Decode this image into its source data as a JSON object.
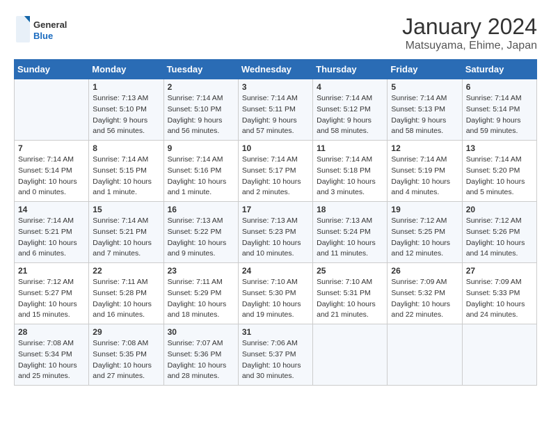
{
  "header": {
    "logo_general": "General",
    "logo_blue": "Blue",
    "title": "January 2024",
    "subtitle": "Matsuyama, Ehime, Japan"
  },
  "days_of_week": [
    "Sunday",
    "Monday",
    "Tuesday",
    "Wednesday",
    "Thursday",
    "Friday",
    "Saturday"
  ],
  "weeks": [
    [
      {
        "num": "",
        "info": ""
      },
      {
        "num": "1",
        "info": "Sunrise: 7:13 AM\nSunset: 5:10 PM\nDaylight: 9 hours\nand 56 minutes."
      },
      {
        "num": "2",
        "info": "Sunrise: 7:14 AM\nSunset: 5:10 PM\nDaylight: 9 hours\nand 56 minutes."
      },
      {
        "num": "3",
        "info": "Sunrise: 7:14 AM\nSunset: 5:11 PM\nDaylight: 9 hours\nand 57 minutes."
      },
      {
        "num": "4",
        "info": "Sunrise: 7:14 AM\nSunset: 5:12 PM\nDaylight: 9 hours\nand 58 minutes."
      },
      {
        "num": "5",
        "info": "Sunrise: 7:14 AM\nSunset: 5:13 PM\nDaylight: 9 hours\nand 58 minutes."
      },
      {
        "num": "6",
        "info": "Sunrise: 7:14 AM\nSunset: 5:14 PM\nDaylight: 9 hours\nand 59 minutes."
      }
    ],
    [
      {
        "num": "7",
        "info": "Sunrise: 7:14 AM\nSunset: 5:14 PM\nDaylight: 10 hours\nand 0 minutes."
      },
      {
        "num": "8",
        "info": "Sunrise: 7:14 AM\nSunset: 5:15 PM\nDaylight: 10 hours\nand 1 minute."
      },
      {
        "num": "9",
        "info": "Sunrise: 7:14 AM\nSunset: 5:16 PM\nDaylight: 10 hours\nand 1 minute."
      },
      {
        "num": "10",
        "info": "Sunrise: 7:14 AM\nSunset: 5:17 PM\nDaylight: 10 hours\nand 2 minutes."
      },
      {
        "num": "11",
        "info": "Sunrise: 7:14 AM\nSunset: 5:18 PM\nDaylight: 10 hours\nand 3 minutes."
      },
      {
        "num": "12",
        "info": "Sunrise: 7:14 AM\nSunset: 5:19 PM\nDaylight: 10 hours\nand 4 minutes."
      },
      {
        "num": "13",
        "info": "Sunrise: 7:14 AM\nSunset: 5:20 PM\nDaylight: 10 hours\nand 5 minutes."
      }
    ],
    [
      {
        "num": "14",
        "info": "Sunrise: 7:14 AM\nSunset: 5:21 PM\nDaylight: 10 hours\nand 6 minutes."
      },
      {
        "num": "15",
        "info": "Sunrise: 7:14 AM\nSunset: 5:21 PM\nDaylight: 10 hours\nand 7 minutes."
      },
      {
        "num": "16",
        "info": "Sunrise: 7:13 AM\nSunset: 5:22 PM\nDaylight: 10 hours\nand 9 minutes."
      },
      {
        "num": "17",
        "info": "Sunrise: 7:13 AM\nSunset: 5:23 PM\nDaylight: 10 hours\nand 10 minutes."
      },
      {
        "num": "18",
        "info": "Sunrise: 7:13 AM\nSunset: 5:24 PM\nDaylight: 10 hours\nand 11 minutes."
      },
      {
        "num": "19",
        "info": "Sunrise: 7:12 AM\nSunset: 5:25 PM\nDaylight: 10 hours\nand 12 minutes."
      },
      {
        "num": "20",
        "info": "Sunrise: 7:12 AM\nSunset: 5:26 PM\nDaylight: 10 hours\nand 14 minutes."
      }
    ],
    [
      {
        "num": "21",
        "info": "Sunrise: 7:12 AM\nSunset: 5:27 PM\nDaylight: 10 hours\nand 15 minutes."
      },
      {
        "num": "22",
        "info": "Sunrise: 7:11 AM\nSunset: 5:28 PM\nDaylight: 10 hours\nand 16 minutes."
      },
      {
        "num": "23",
        "info": "Sunrise: 7:11 AM\nSunset: 5:29 PM\nDaylight: 10 hours\nand 18 minutes."
      },
      {
        "num": "24",
        "info": "Sunrise: 7:10 AM\nSunset: 5:30 PM\nDaylight: 10 hours\nand 19 minutes."
      },
      {
        "num": "25",
        "info": "Sunrise: 7:10 AM\nSunset: 5:31 PM\nDaylight: 10 hours\nand 21 minutes."
      },
      {
        "num": "26",
        "info": "Sunrise: 7:09 AM\nSunset: 5:32 PM\nDaylight: 10 hours\nand 22 minutes."
      },
      {
        "num": "27",
        "info": "Sunrise: 7:09 AM\nSunset: 5:33 PM\nDaylight: 10 hours\nand 24 minutes."
      }
    ],
    [
      {
        "num": "28",
        "info": "Sunrise: 7:08 AM\nSunset: 5:34 PM\nDaylight: 10 hours\nand 25 minutes."
      },
      {
        "num": "29",
        "info": "Sunrise: 7:08 AM\nSunset: 5:35 PM\nDaylight: 10 hours\nand 27 minutes."
      },
      {
        "num": "30",
        "info": "Sunrise: 7:07 AM\nSunset: 5:36 PM\nDaylight: 10 hours\nand 28 minutes."
      },
      {
        "num": "31",
        "info": "Sunrise: 7:06 AM\nSunset: 5:37 PM\nDaylight: 10 hours\nand 30 minutes."
      },
      {
        "num": "",
        "info": ""
      },
      {
        "num": "",
        "info": ""
      },
      {
        "num": "",
        "info": ""
      }
    ]
  ]
}
